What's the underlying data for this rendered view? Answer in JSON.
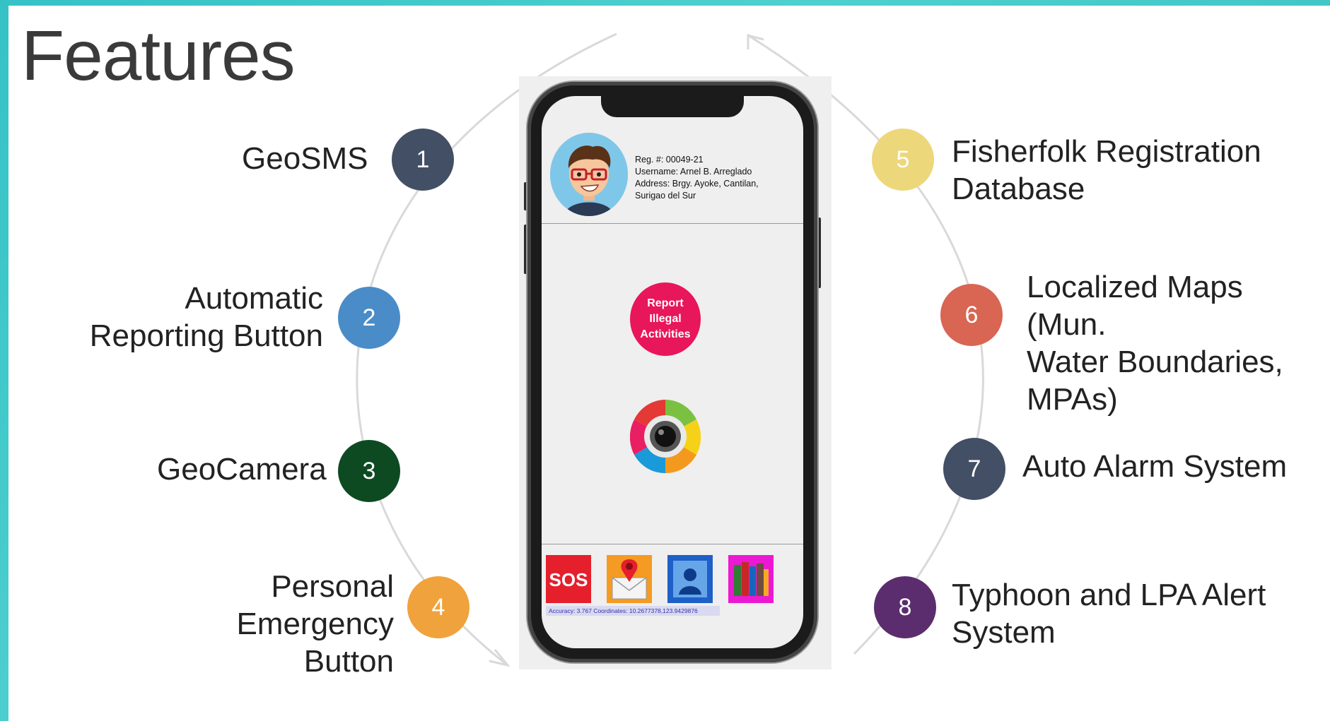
{
  "title": "Features",
  "features": [
    {
      "num": "1",
      "label": "GeoSMS",
      "color": "#424f65"
    },
    {
      "num": "2",
      "label": "Automatic\nReporting Button",
      "color": "#4a8cc8"
    },
    {
      "num": "3",
      "label": "GeoCamera",
      "color": "#0d4a22"
    },
    {
      "num": "4",
      "label": "Personal\nEmergency\nButton",
      "color": "#f0a23c"
    },
    {
      "num": "5",
      "label": "Fisherfolk Registration\nDatabase",
      "color": "#ecd77a"
    },
    {
      "num": "6",
      "label": "Localized Maps (Mun.\nWater Boundaries,\nMPAs)",
      "color": "#d96553"
    },
    {
      "num": "7",
      "label": "Auto Alarm System",
      "color": "#424f65"
    },
    {
      "num": "8",
      "label": "Typhoon and LPA Alert\nSystem",
      "color": "#5b2d6e"
    }
  ],
  "profile": {
    "reg": "Reg. #: 00049-21",
    "username": "Username: Arnel B. Arreglado",
    "address": "Address: Brgy. Ayoke, Cantilan,",
    "address2": "Surigao del Sur"
  },
  "report_button": "Report\nIllegal\nActivities",
  "sos_label": "SOS",
  "status_bar": "Accuracy: 3.767  Coordinates: 10.2677378,123.9429876",
  "icons": [
    "sos-icon",
    "map-message-icon",
    "contact-icon",
    "library-books-icon"
  ]
}
